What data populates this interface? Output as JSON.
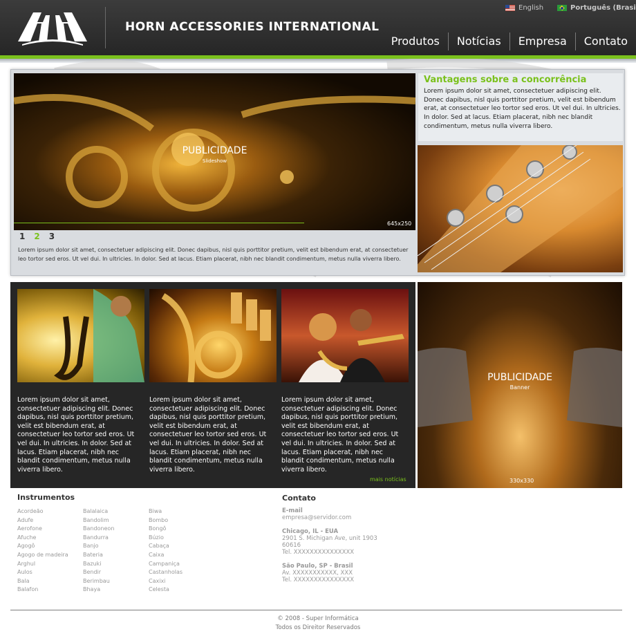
{
  "header": {
    "brand": "HORN ACCESSORIES INTERNATIONAL",
    "languages": [
      {
        "label": "English",
        "flag": "us-flag-icon"
      },
      {
        "label": "Português (Brasil)",
        "flag": "brazil-flag-icon"
      }
    ],
    "nav": [
      "Produtos",
      "Notícias",
      "Empresa",
      "Contato"
    ]
  },
  "colors": {
    "accent": "#7ac11c",
    "header": "#2f2f2f",
    "panel": "#d9dce0",
    "dark_panel": "#262626"
  },
  "slideshow": {
    "title": "PUBLICIDADE",
    "subtitle": "Slideshow",
    "size": "645x250",
    "pages": [
      "1",
      "2",
      "3"
    ],
    "active_page": "2",
    "caption": "Lorem ipsum dolor sit amet, consectetuer adipiscing elit. Donec dapibus, nisl quis porttitor pretium, velit est bibendum erat, at consectetuer leo tortor sed eros. Ut vel dui. In ultricies. In dolor. Sed at lacus. Etiam placerat, nibh nec blandit condimentum, metus nulla viverra libero."
  },
  "advantages": {
    "title": "Vantagens sobre a concorrência",
    "text": "Lorem ipsum dolor sit amet, consectetuer adipiscing elit. Donec dapibus, nisl quis porttitor pretium, velit est bibendum erat, at consectetuer leo tortor sed eros. Ut vel dui. In ultricies. In dolor. Sed at lacus. Etiam placerat, nibh nec blandit condimentum, metus nulla viverra libero."
  },
  "news": {
    "items": [
      {
        "image": "saxophone-player-photo",
        "text": "Lorem ipsum dolor sit amet, consectetuer adipiscing elit. Donec dapibus, nisl quis porttitor pretium, velit est bibendum erat, at consectetuer leo tortor sed eros. Ut vel dui. In ultricies. In dolor. Sed at lacus. Etiam placerat, nibh nec blandit condimentum, metus nulla viverra libero."
      },
      {
        "image": "brass-instrument-photo",
        "text": "Lorem ipsum dolor sit amet, consectetuer adipiscing elit. Donec dapibus, nisl quis porttitor pretium, velit est bibendum erat, at consectetuer leo tortor sed eros. Ut vel dui. In ultricies. In dolor. Sed at lacus. Etiam placerat, nibh nec blandit condimentum, metus nulla viverra libero."
      },
      {
        "image": "band-performance-photo",
        "text": "Lorem ipsum dolor sit amet, consectetuer adipiscing elit. Donec dapibus, nisl quis porttitor pretium, velit est bibendum erat, at consectetuer leo tortor sed eros. Ut vel dui. In ultricies. In dolor. Sed at lacus. Etiam placerat, nibh nec blandit condimentum, metus nulla viverra libero."
      }
    ],
    "more": "mais notícias"
  },
  "banner": {
    "title": "PUBLICIDADE",
    "subtitle": "Banner",
    "size": "330x330"
  },
  "instruments": {
    "title": "Instrumentos",
    "columns": [
      [
        "Acordeão",
        "Adufe",
        "Aerofone",
        "Afuche",
        "Agogô",
        "Agogo de madeira",
        "Arghul",
        "Aulos",
        "Bala",
        "Balafon"
      ],
      [
        "Balalaica",
        "Bandolim",
        "Bandoneon",
        "Bandurra",
        "Banjo",
        "Bateria",
        "Bazuki",
        "Bendir",
        "Berimbau",
        "Bhaya"
      ],
      [
        "Biwa",
        "Bombo",
        "Bongô",
        "Búzio",
        "Cabaça",
        "Caixa",
        "Campaniça",
        "Castanholas",
        "Caxixi",
        "Celesta"
      ]
    ]
  },
  "contact": {
    "title": "Contato",
    "email_label": "E-mail",
    "email": "empresa@servidor.com",
    "chicago": {
      "title": "Chicago, IL - EUA",
      "lines": [
        "2901 S. Michigan Ave, unit 1903",
        "60616",
        "Tel. XXXXXXXXXXXXXXX"
      ]
    },
    "sao_paulo": {
      "title": "São Paulo, SP - Brasil",
      "lines": [
        "Av. XXXXXXXXXXX, XXX",
        "Tel. XXXXXXXXXXXXXXX"
      ]
    }
  },
  "footer": {
    "copyright": "© 2008 - Super Informática",
    "rights": "Todos os Direitor Reservados"
  }
}
